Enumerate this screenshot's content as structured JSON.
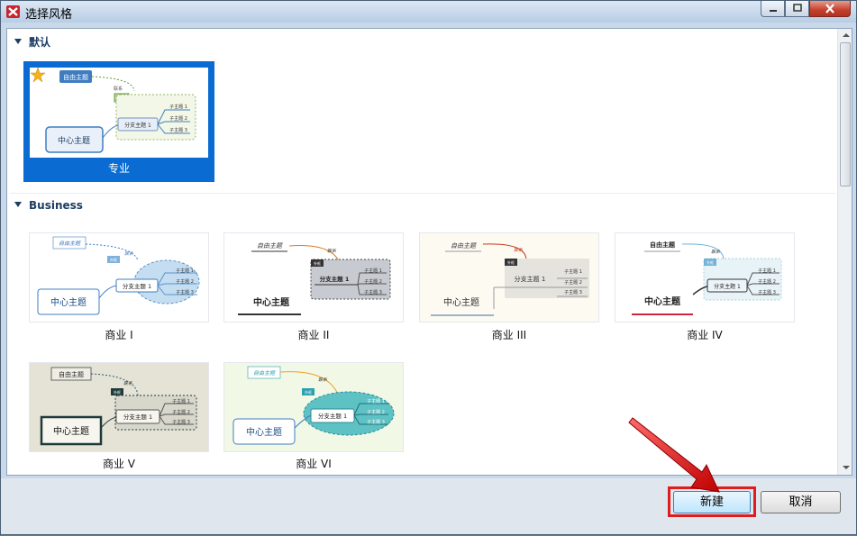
{
  "window": {
    "title": "选择风格"
  },
  "sections": [
    {
      "name": "默认",
      "styles": [
        {
          "label": "专业",
          "selected": true,
          "favorite": true
        }
      ]
    },
    {
      "name": "Business",
      "styles": [
        {
          "label": "商业 I"
        },
        {
          "label": "商业 II"
        },
        {
          "label": "商业 III"
        },
        {
          "label": "商业 IV"
        },
        {
          "label": "商业 V"
        },
        {
          "label": "商业 VI"
        }
      ]
    }
  ],
  "preview_text": {
    "central": "中心主题",
    "floating": "自由主题",
    "branch": "分支主题 1",
    "sub1": "子主题 1",
    "sub2": "子主题 2",
    "sub3": "子主题 3",
    "relation": "联系",
    "boundary": "外框"
  },
  "footer": {
    "new_label": "新建",
    "cancel_label": "取消"
  },
  "colors": {
    "selection": "#0a6cd3",
    "highlight": "#e01c1c",
    "section_header": "#1d3d63"
  }
}
